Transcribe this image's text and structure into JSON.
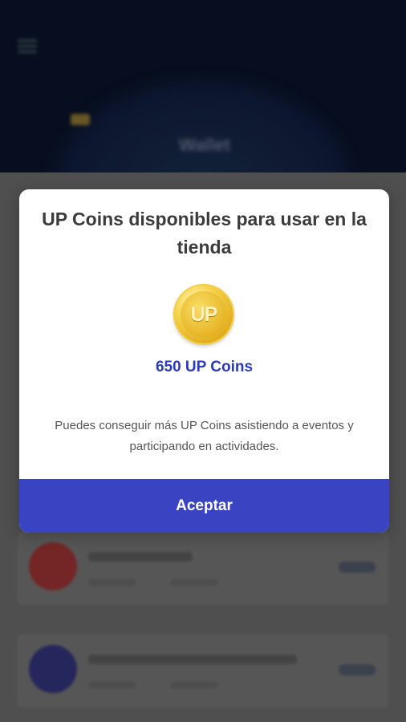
{
  "background": {
    "header_title": "Wallet",
    "cards": [
      {
        "title": "Mes - Leaderoll",
        "avatar_color": "#b33a3a"
      },
      {
        "title": "Promo por el Gerente Academico",
        "avatar_color": "#3a3d8e"
      }
    ]
  },
  "modal": {
    "title": "UP Coins disponibles para usar en la tienda",
    "coin_label": "UP",
    "coin_amount": "650 UP Coins",
    "description": "Puedes conseguir más UP Coins asistiendo a eventos y participando en actividades.",
    "accept_label": "Aceptar"
  },
  "colors": {
    "accent": "#3a43c1",
    "amount": "#2b3bb5",
    "header": "#0b1630"
  }
}
